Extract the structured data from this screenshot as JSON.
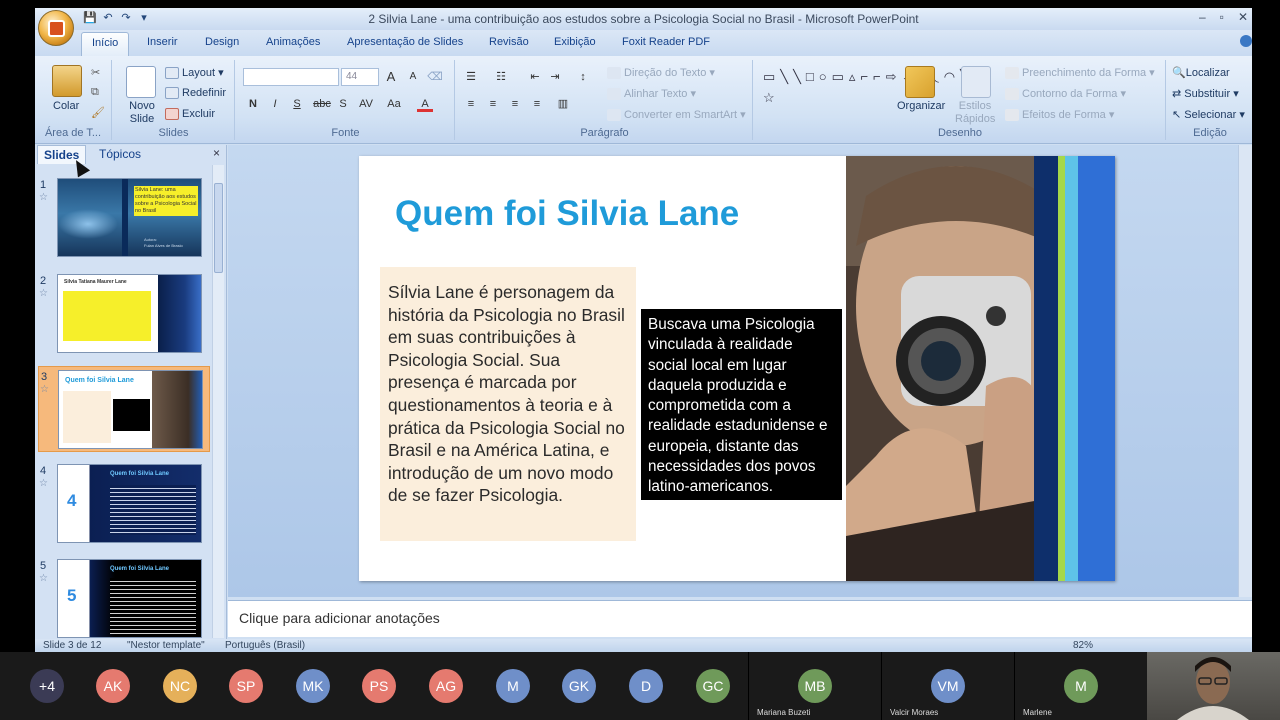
{
  "window": {
    "title": "2 Silvia Lane - uma contribuição aos estudos sobre a Psicologia Social no Brasil - Microsoft PowerPoint",
    "minimize": "–",
    "restore": "▫",
    "close": "✕"
  },
  "ribbon": {
    "tabs": [
      "Início",
      "Inserir",
      "Design",
      "Animações",
      "Apresentação de Slides",
      "Revisão",
      "Exibição",
      "Foxit Reader PDF"
    ],
    "clipboard": {
      "paste": "Colar",
      "group": "Área de T..."
    },
    "slides": {
      "new_slide": "Novo Slide",
      "layout": "Layout",
      "reset": "Redefinir",
      "delete": "Excluir",
      "group": "Slides"
    },
    "font": {
      "size": "44",
      "group": "Fonte",
      "bold": "N",
      "italic": "I",
      "underline": "S",
      "strike": "abc",
      "shadow": "S",
      "spacing": "AV",
      "case": "Aa",
      "color": "A",
      "grow": "A",
      "shrink": "A"
    },
    "paragraph": {
      "text_direction": "Direção do Texto",
      "align_text": "Alinhar Texto",
      "smartart": "Converter em SmartArt",
      "group": "Parágrafo"
    },
    "drawing": {
      "arrange": "Organizar",
      "quick_styles": "Estilos Rápidos",
      "shape_fill": "Preenchimento da Forma",
      "shape_outline": "Contorno da Forma",
      "shape_effects": "Efeitos de Forma",
      "group": "Desenho"
    },
    "editing": {
      "find": "Localizar",
      "replace": "Substituir",
      "select": "Selecionar",
      "group": "Edição"
    }
  },
  "slides_pane": {
    "tab_slides": "Slides",
    "tab_outline": "Tópicos",
    "close": "×",
    "thumbs": [
      {
        "num": "1",
        "title": "Silvia Lane: uma contribuição aos estudos sobre a Psicologia Social no Brasil",
        "sub": "Autora:",
        "author": "Fulan Alves de Brasio"
      },
      {
        "num": "2",
        "title": "Silvia Tatiana Maurer Lane"
      },
      {
        "num": "3",
        "title": "Quem foi Silvia Lane"
      },
      {
        "num": "4",
        "title": "Quem foi Silvia Lane",
        "big": "4"
      },
      {
        "num": "5",
        "title": "Quem foi Silvia Lane",
        "big": "5"
      }
    ]
  },
  "slide": {
    "title": "Quem foi Silvia Lane",
    "left_text": "Sílvia Lane é personagem da história da Psicologia no Brasil em suas contribuições à Psicologia Social. Sua presença é marcada por questionamentos à teoria e à prática da Psicologia Social no Brasil e na América Latina, e introdução de um novo modo de se fazer Psicologia.",
    "right_text": "Buscava uma Psicologia vinculada à realidade social local em lugar daquela produzida e comprometida com a realidade estadunidense e europeia, distante das necessidades dos povos latino-americanos.",
    "number": "3"
  },
  "notes": {
    "placeholder": "Clique para adicionar anotações"
  },
  "status": {
    "slide_count": "Slide 3 de 12",
    "template": "\"Nestor template\"",
    "language": "Português (Brasil)",
    "zoom": "82%"
  },
  "meeting": {
    "more": "+4",
    "participants": [
      {
        "initials": "AK",
        "color": "#e57a6f"
      },
      {
        "initials": "NC",
        "color": "#e5b05a"
      },
      {
        "initials": "SP",
        "color": "#e57a6f"
      },
      {
        "initials": "MK",
        "color": "#6f8fc9"
      },
      {
        "initials": "PS",
        "color": "#e57a6f"
      },
      {
        "initials": "AG",
        "color": "#e57a6f"
      },
      {
        "initials": "M",
        "color": "#6f8fc9"
      },
      {
        "initials": "GK",
        "color": "#6f8fc9"
      },
      {
        "initials": "D",
        "color": "#6f8fc9"
      },
      {
        "initials": "GC",
        "color": "#6f9a5a"
      }
    ],
    "tiles": [
      {
        "initials": "MB",
        "name": "Mariana Buzeti",
        "color": "#6f9a5a"
      },
      {
        "initials": "VM",
        "name": "Valcir Moraes",
        "color": "#6f8fc9"
      },
      {
        "initials": "M",
        "name": "Marlene",
        "color": "#6f9a5a"
      }
    ]
  }
}
